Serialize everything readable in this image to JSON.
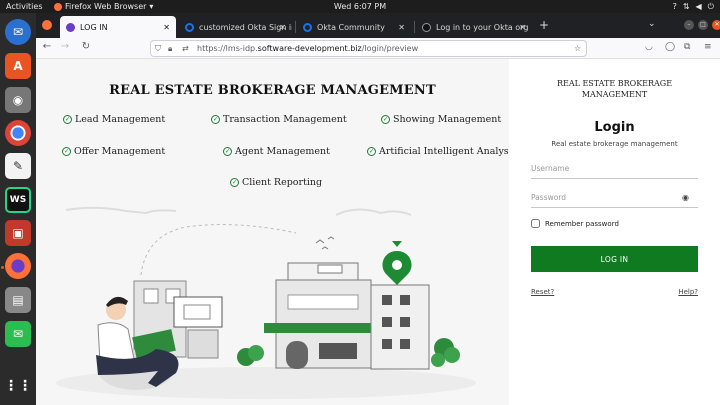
{
  "system": {
    "activities": "Activities",
    "app_name": "Firefox Web Browser",
    "clock": "Wed  6:07 PM"
  },
  "browser": {
    "tabs": [
      {
        "label": "LOG IN",
        "active": true
      },
      {
        "label": "customized Okta Sign in",
        "active": false
      },
      {
        "label": "Okta Community",
        "active": false
      },
      {
        "label": "Log in to your Okta org",
        "active": false
      }
    ],
    "url_scheme": "https://lms-idp.",
    "url_host": "software-development.biz",
    "url_path": "/login/preview"
  },
  "page": {
    "headline": "REAL ESTATE BROKERAGE MANAGEMENT",
    "features": [
      "Lead Management",
      "Transaction Management",
      "Showing Management",
      "Offer Management",
      "Agent Management",
      "Artificial Intelligent Analysis",
      "Client Reporting"
    ]
  },
  "login": {
    "org_line1": "REAL ESTATE BROKERAGE",
    "org_line2": "MANAGEMENT",
    "title": "Login",
    "subtitle": "Real estate brokerage management",
    "username_placeholder": "Username",
    "password_placeholder": "Password",
    "remember_label": "Remember password",
    "button_label": "LOG IN",
    "reset_label": "Reset?",
    "help_label": "Help?"
  },
  "colors": {
    "brand_green": "#0f7a1f",
    "titlebar": "#1d1d1d",
    "dock": "#2b2b2b",
    "tabstrip": "#202124"
  }
}
